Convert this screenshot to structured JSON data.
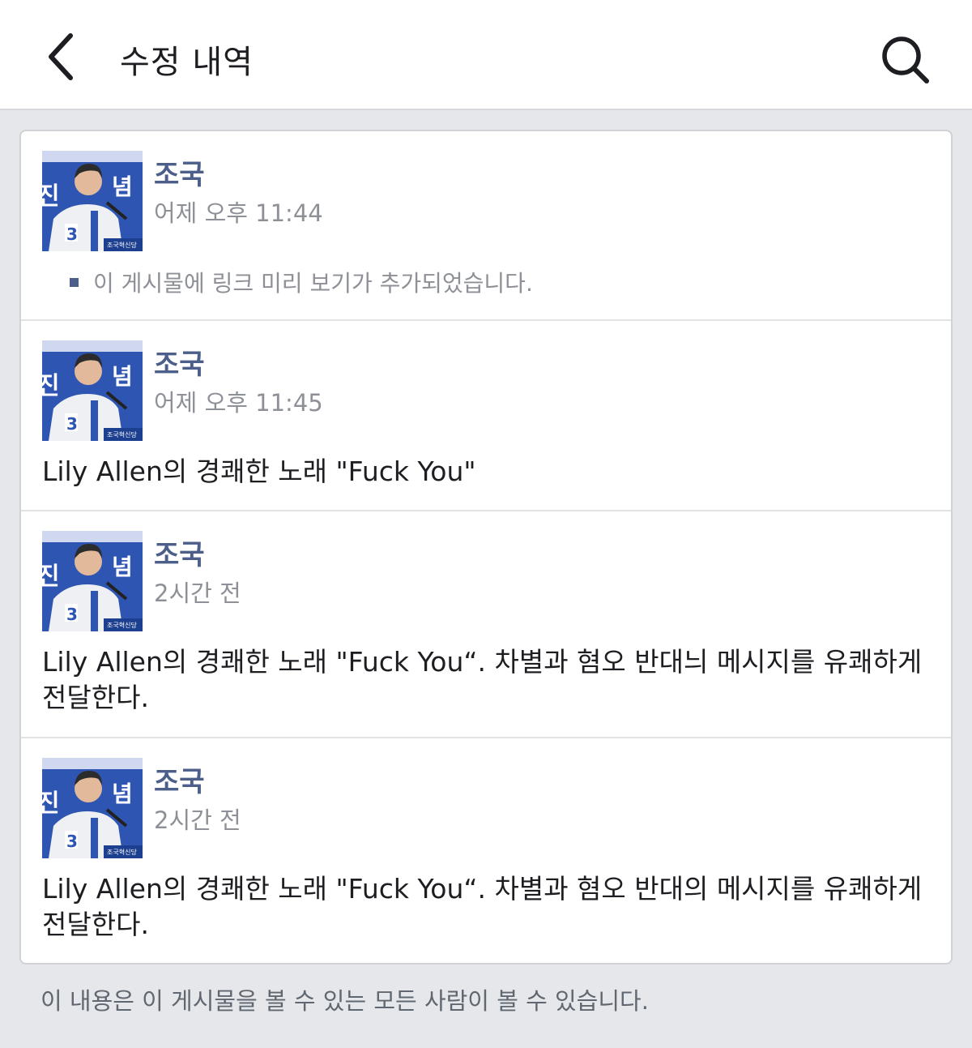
{
  "header": {
    "title": "수정 내역",
    "back_icon": "chevron-left-icon",
    "search_icon": "search-icon"
  },
  "entries": [
    {
      "author": "조국",
      "time": "어제 오후 11:44",
      "note": "이 게시물에 링크 미리 보기가 추가되었습니다.",
      "text": ""
    },
    {
      "author": "조국",
      "time": "어제 오후 11:45",
      "note": "",
      "text": "Lily Allen의 경쾌한 노래 \"Fuck You\""
    },
    {
      "author": "조국",
      "time": "2시간 전",
      "note": "",
      "text": "Lily Allen의 경쾌한 노래 \"Fuck You“. 차별과 혐오 반대늬 메시지를 유쾌하게 전달한다."
    },
    {
      "author": "조국",
      "time": "2시간 전",
      "note": "",
      "text": "Lily Allen의 경쾌한 노래 \"Fuck You“. 차별과 혐오 반대의 메시지를 유쾌하게 전달한다."
    }
  ],
  "avatar_photo_text": [
    "3",
    "조국혁신당",
    "진",
    "념"
  ],
  "footer": {
    "text": "이 내용은 이 게시물을 볼 수 있는 모든 사람이 볼 수 있습니다."
  },
  "colors": {
    "author": "#4b5f8a",
    "meta": "#8d9096",
    "background": "#e5e7ea"
  }
}
